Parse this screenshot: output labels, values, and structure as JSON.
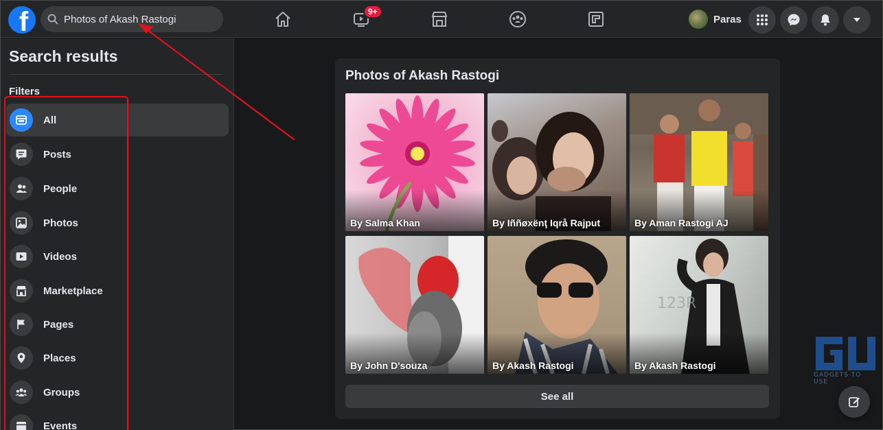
{
  "topbar": {
    "logo_letter": "f",
    "search_value": "Photos of Akash Rastogi",
    "video_badge": "9+",
    "profile_name": "Paras"
  },
  "sidebar": {
    "title": "Search results",
    "filters_label": "Filters",
    "items": [
      {
        "label": "All",
        "icon": "all-icon",
        "active": true
      },
      {
        "label": "Posts",
        "icon": "posts-icon"
      },
      {
        "label": "People",
        "icon": "people-icon"
      },
      {
        "label": "Photos",
        "icon": "photos-icon"
      },
      {
        "label": "Videos",
        "icon": "videos-icon"
      },
      {
        "label": "Marketplace",
        "icon": "marketplace-icon"
      },
      {
        "label": "Pages",
        "icon": "pages-flag-icon"
      },
      {
        "label": "Places",
        "icon": "places-pin-icon"
      },
      {
        "label": "Groups",
        "icon": "groups-icon"
      },
      {
        "label": "Events",
        "icon": "events-icon"
      }
    ]
  },
  "results": {
    "title": "Photos of Akash Rastogi",
    "photos": [
      {
        "caption": "By Salma Khan"
      },
      {
        "caption": "By Iññøxënţ Iqrå Rajput"
      },
      {
        "caption": "By Aman Rastogi AJ"
      },
      {
        "caption": "By John D'souza"
      },
      {
        "caption": "By Akash Rastogi"
      },
      {
        "caption": "By Akash Rastogi"
      }
    ],
    "see_all": "See all"
  },
  "colors": {
    "accent": "#2d88ff",
    "annotation_red": "#e0121b",
    "badge_red": "#e41e3f"
  }
}
